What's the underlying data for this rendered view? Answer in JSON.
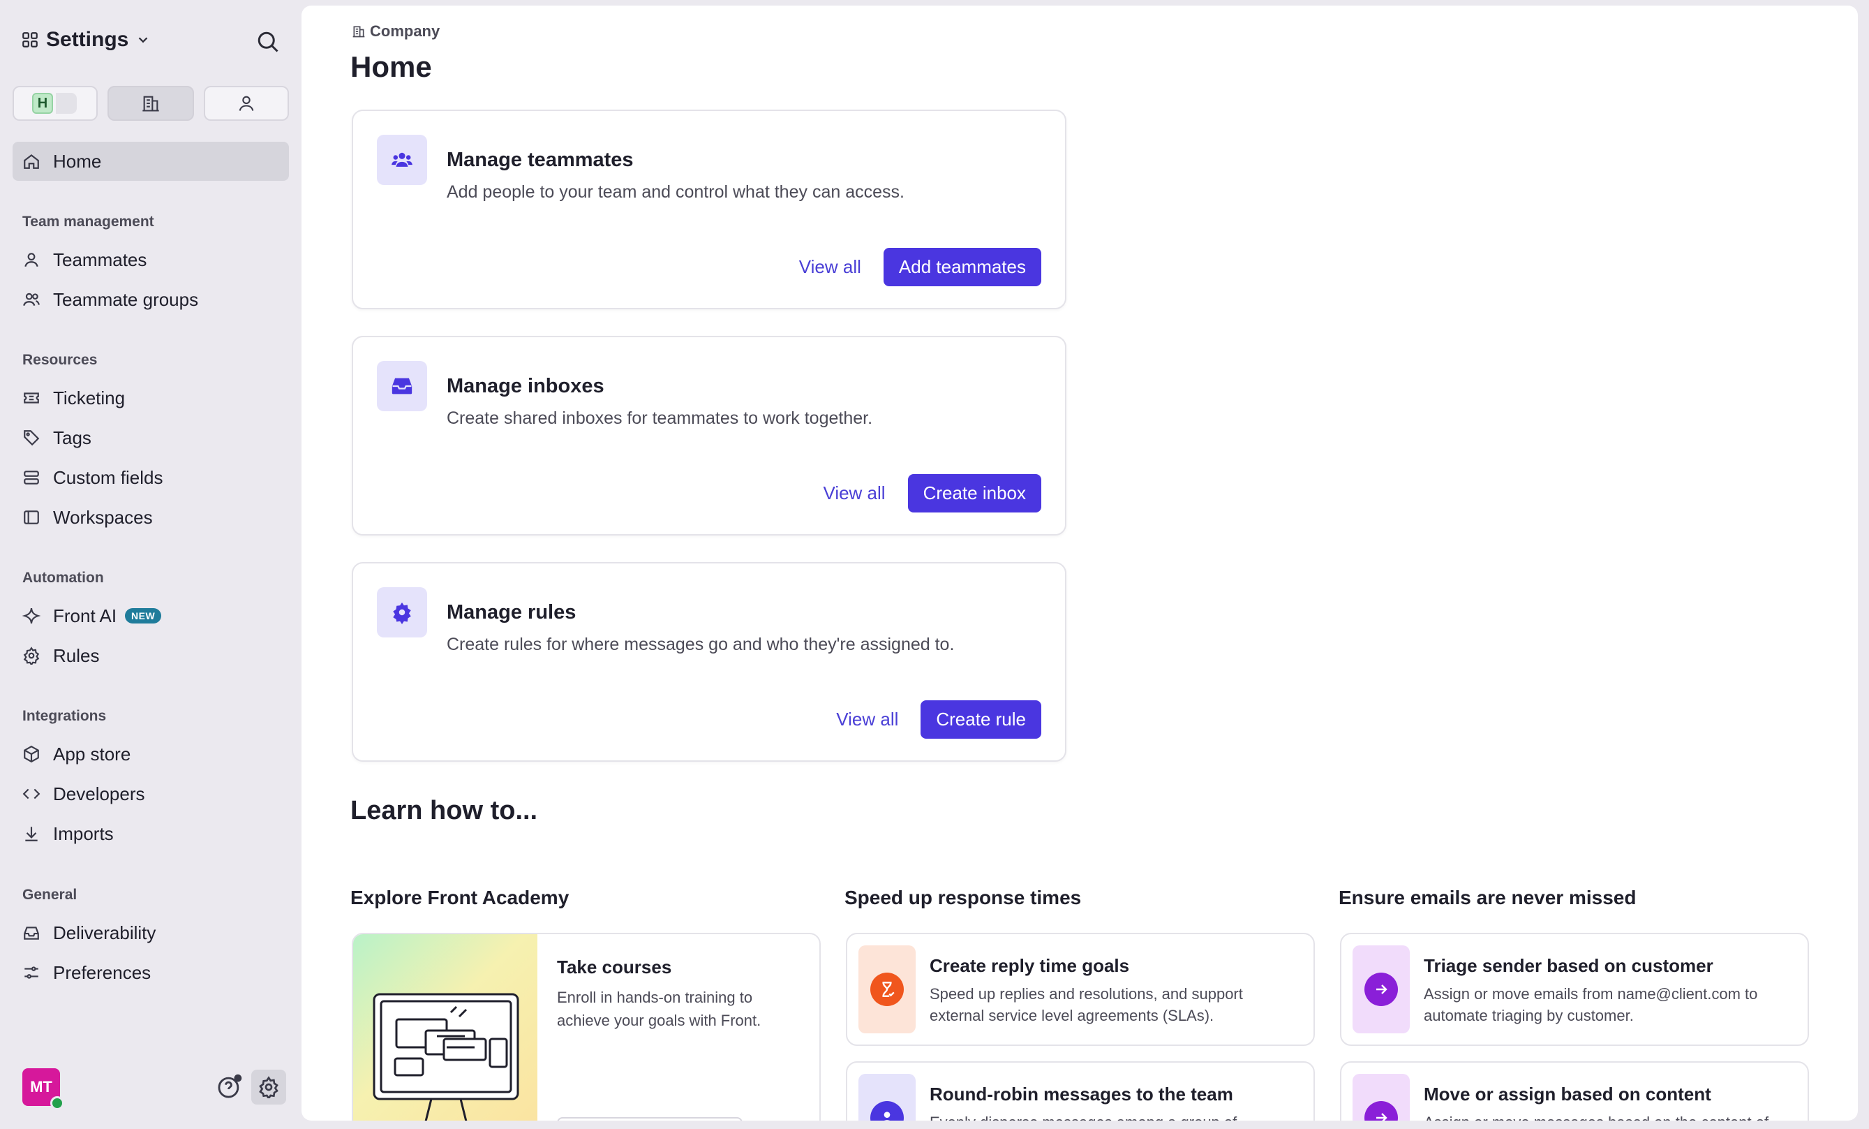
{
  "sidebar": {
    "title": "Settings",
    "workspace_badge": "H",
    "items": {
      "home": "Home",
      "teammates": "Teammates",
      "teammate_groups": "Teammate groups",
      "ticketing": "Ticketing",
      "tags": "Tags",
      "custom_fields": "Custom fields",
      "workspaces": "Workspaces",
      "front_ai": "Front AI",
      "rules": "Rules",
      "app_store": "App store",
      "developers": "Developers",
      "imports": "Imports",
      "deliverability": "Deliverability",
      "preferences": "Preferences"
    },
    "sections": {
      "team_management": "Team management",
      "resources": "Resources",
      "automation": "Automation",
      "integrations": "Integrations",
      "general": "General"
    },
    "new_badge": "NEW",
    "user_initials": "MT"
  },
  "main": {
    "breadcrumb": "Company",
    "title": "Home",
    "cards": [
      {
        "title": "Manage teammates",
        "desc": "Add people to your team and control what they can access.",
        "link": "View all",
        "button": "Add teammates"
      },
      {
        "title": "Manage inboxes",
        "desc": "Create shared inboxes for teammates to work together.",
        "link": "View all",
        "button": "Create inbox"
      },
      {
        "title": "Manage rules",
        "desc": "Create rules for where messages go and who they're assigned to.",
        "link": "View all",
        "button": "Create rule"
      }
    ],
    "learn": {
      "title": "Learn how to...",
      "columns": [
        {
          "title": "Explore Front Academy"
        },
        {
          "title": "Speed up response times"
        },
        {
          "title": "Ensure emails are never missed"
        }
      ],
      "academy": {
        "title": "Take courses",
        "desc": "Enroll in hands-on training to achieve your goals with Front."
      },
      "speed": [
        {
          "title": "Create reply time goals",
          "desc": "Speed up replies and resolutions, and support external service level agreements (SLAs)."
        },
        {
          "title": "Round-robin messages to the team",
          "desc": "Evenly disperse messages among a group of"
        }
      ],
      "ensure": [
        {
          "title": "Triage sender based on customer",
          "desc": "Assign or move emails from name@client.com to automate triaging by customer."
        },
        {
          "title": "Move or assign based on content",
          "desc": "Assign or move messages based on the content of"
        }
      ]
    }
  },
  "colors": {
    "accent": "#4a36e0",
    "link": "#4a3fd6",
    "avatar": "#d6189b",
    "new_badge": "#1f7c9b",
    "sidebar_bg": "#ebe9ef",
    "orange": "#f0561d",
    "purple": "#8a1fd8"
  }
}
